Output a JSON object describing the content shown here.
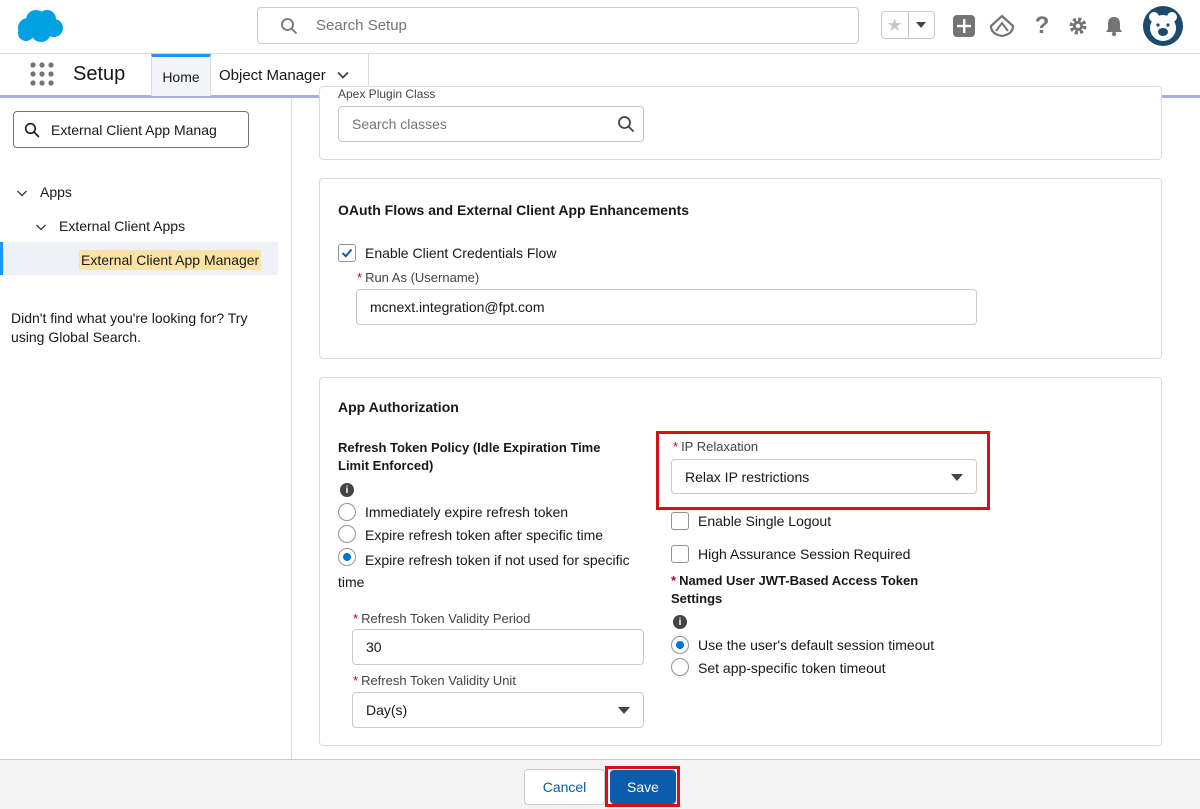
{
  "global_header": {
    "search_placeholder": "Search Setup",
    "icons": [
      "star-icon",
      "chevron-down-icon",
      "add-icon",
      "trailhead-icon",
      "help-icon",
      "gear-icon",
      "bell-icon",
      "avatar"
    ]
  },
  "app_nav": {
    "app_name": "Setup",
    "tabs": [
      {
        "label": "Home",
        "active": true
      },
      {
        "label": "Object Manager",
        "active": false
      }
    ]
  },
  "sidebar": {
    "quickfind_value": "External Client App Manag",
    "tree": [
      {
        "label": "Apps",
        "level": 0,
        "expanded": true
      },
      {
        "label": "External Client Apps",
        "level": 1,
        "expanded": true
      },
      {
        "label": "External Client App Manager",
        "level": 2,
        "selected": true
      }
    ],
    "help_text": "Didn't find what you're looking for? Try using Global Search."
  },
  "main": {
    "top_card": {
      "partial_label": "Apex Plugin Class",
      "search_placeholder": "Search classes"
    },
    "oauth_card": {
      "title": "OAuth Flows and External Client App Enhancements",
      "enable_ccf_label": "Enable Client Credentials Flow",
      "enable_ccf_checked": true,
      "run_as_label": "Run As (Username)",
      "run_as_value": "mcnext.integration@fpt.com"
    },
    "auth_card": {
      "title": "App Authorization",
      "refresh_policy_label": "Refresh Token Policy (Idle Expiration Time Limit Enforced)",
      "refresh_options": [
        {
          "label": "Immediately expire refresh token",
          "selected": false
        },
        {
          "label": "Expire refresh token after specific time",
          "selected": false
        },
        {
          "label": "Expire refresh token if not used for specific time",
          "selected": true
        }
      ],
      "validity_period_label": "Refresh Token Validity Period",
      "validity_period_value": "30",
      "validity_unit_label": "Refresh Token Validity Unit",
      "validity_unit_value": "Day(s)",
      "ip_relaxation_label": "IP Relaxation",
      "ip_relaxation_value": "Relax IP restrictions",
      "single_logout_label": "Enable Single Logout",
      "single_logout_checked": false,
      "high_assurance_label": "High Assurance Session Required",
      "high_assurance_checked": false,
      "jwt_label": "Named User JWT-Based Access Token Settings",
      "jwt_options": [
        {
          "label": "Use the user's default session timeout",
          "selected": true
        },
        {
          "label": "Set app-specific token timeout",
          "selected": false
        }
      ]
    }
  },
  "footer": {
    "cancel_label": "Cancel",
    "save_label": "Save"
  },
  "colors": {
    "brand": "#0b5cab",
    "highlight": "#d1121a",
    "required": "#ba0517",
    "selected_bg": "#fbe3a5"
  }
}
